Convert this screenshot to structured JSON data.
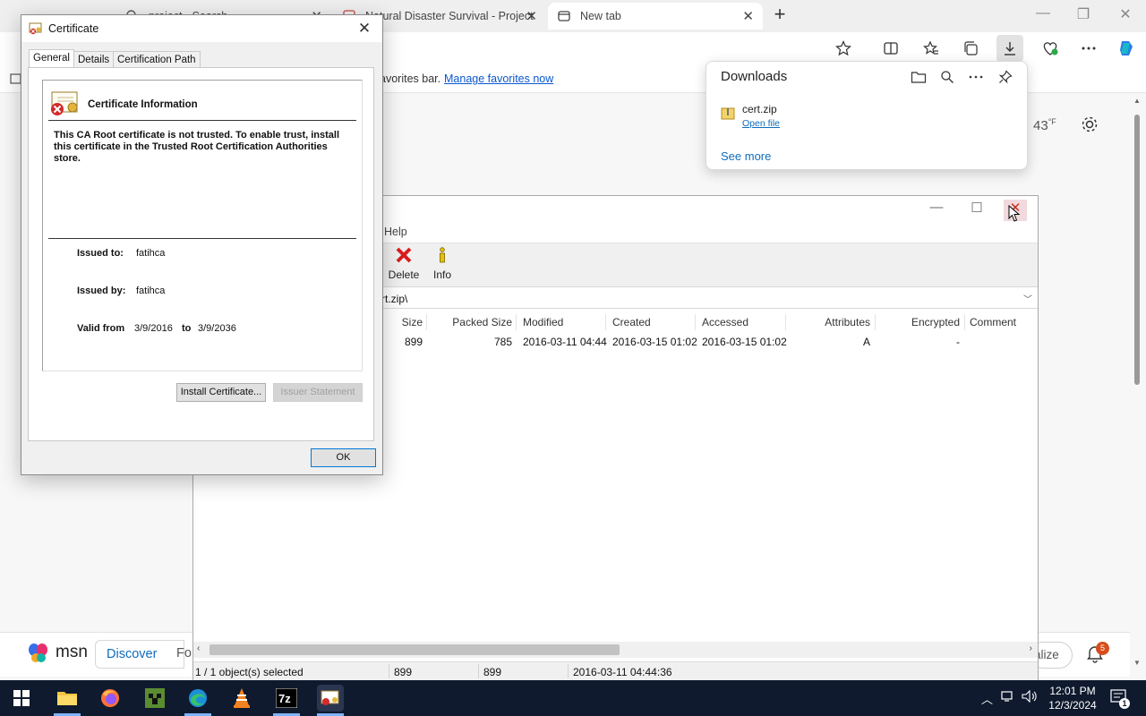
{
  "browser": {
    "tabs": [
      {
        "label": "project - Search"
      },
      {
        "label": "Natural Disaster Survival - Project"
      },
      {
        "label": "New tab"
      }
    ],
    "favorites_bar_text": "avorites bar.",
    "favorites_link": "Manage favorites now",
    "weather_temp": "43",
    "weather_unit": "°F"
  },
  "downloads": {
    "title": "Downloads",
    "file_name": "cert.zip",
    "open_file": "Open file",
    "see_more": "See more"
  },
  "msn": {
    "logo": "msn",
    "discover": "Discover",
    "next_tab": "Fo",
    "personalize": "alize",
    "notification_count": "5"
  },
  "zip": {
    "menu_help": "Help",
    "toolbar": {
      "delete": "Delete",
      "info": "Info"
    },
    "address": "rt.zip\\",
    "columns": {
      "size": "Size",
      "packed": "Packed Size",
      "modified": "Modified",
      "created": "Created",
      "accessed": "Accessed",
      "attributes": "Attributes",
      "encrypted": "Encrypted",
      "comment": "Comment"
    },
    "row": {
      "size": "899",
      "packed": "785",
      "modified": "2016-03-11 04:44",
      "created": "2016-03-15 01:02",
      "accessed": "2016-03-15 01:02",
      "attributes": "A",
      "encrypted": "-"
    },
    "status": {
      "selected": "1 / 1 object(s) selected",
      "size": "899",
      "packed": "899",
      "modified": "2016-03-11 04:44:36"
    }
  },
  "cert": {
    "title": "Certificate",
    "tabs": [
      "General",
      "Details",
      "Certification Path"
    ],
    "info_title": "Certificate Information",
    "warning": "This CA Root certificate is not trusted. To enable trust, install this certificate in the Trusted Root Certification Authorities store.",
    "issued_to_label": "Issued to:",
    "issued_to": "fatihca",
    "issued_by_label": "Issued by:",
    "issued_by": "fatihca",
    "valid_from_label": "Valid from",
    "valid_from": "3/9/2016",
    "to_label": "to",
    "valid_to": "3/9/2036",
    "install_btn": "Install Certificate...",
    "issuer_btn": "Issuer Statement",
    "ok_btn": "OK"
  },
  "taskbar": {
    "time": "12:01 PM",
    "date": "12/3/2024",
    "notification_count": "1"
  },
  "colors": {
    "accent": "#0078d7",
    "link": "#0f6cbd",
    "taskbar": "#0f1a2e",
    "error_red": "#d81e1e"
  },
  "icons": [
    "search-icon",
    "star-icon",
    "split-screen-icon",
    "favorites-icon",
    "collections-icon",
    "download-icon",
    "performance-icon",
    "more-icon",
    "copilot-icon",
    "folder-icon",
    "pin-icon",
    "gear-icon",
    "delete-icon",
    "info-icon",
    "certificate-icon",
    "bell-icon",
    "windows-start-icon"
  ]
}
